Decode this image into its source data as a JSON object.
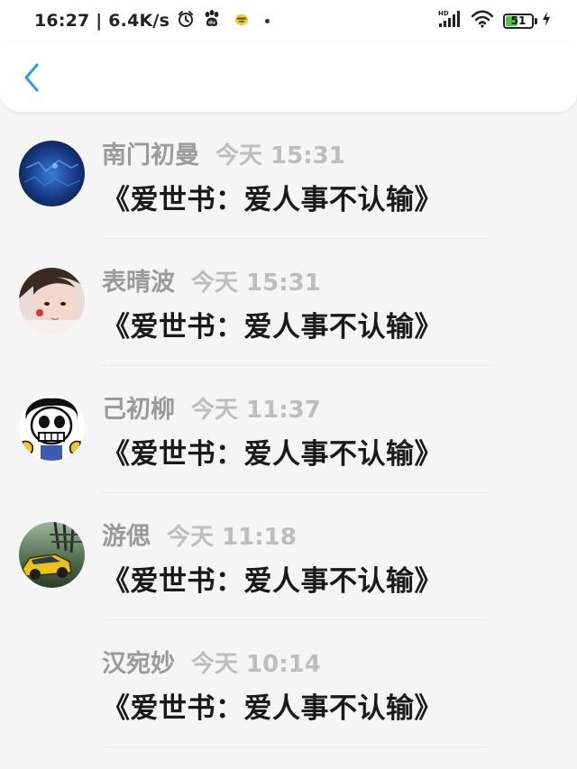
{
  "status_bar": {
    "time": "16:27 | 6.4K/s",
    "battery_level": "51",
    "battery_percent": 51,
    "network_label": "HD",
    "icons": [
      "alarm-icon",
      "paw-icon",
      "app-notification-icon",
      "dot-icon",
      "hd-signal-icon",
      "wifi-icon",
      "battery-icon",
      "charging-icon"
    ]
  },
  "header": {
    "back_icon": "chevron-left-icon",
    "accent_color": "#2f9be4"
  },
  "messages": [
    {
      "name": "南门初曼",
      "time": "今天 15:31",
      "text": "《爱世书：爱人事不认输》",
      "avatar": "dark-blue-avatar"
    },
    {
      "name": "表晴波",
      "time": "今天 15:31",
      "text": "《爱世书：爱人事不认输》",
      "avatar": "girl-photo-avatar"
    },
    {
      "name": "己初柳",
      "time": "今天 11:37",
      "text": "《爱世书：爱人事不认输》",
      "avatar": "skeleton-cartoon-avatar"
    },
    {
      "name": "游偲",
      "time": "今天 11:18",
      "text": "《爱世书：爱人事不认输》",
      "avatar": "yellow-car-avatar"
    },
    {
      "name": "汉宛妙",
      "time": "今天 10:14",
      "text": "《爱世书：爱人事不认输》",
      "avatar": ""
    }
  ]
}
